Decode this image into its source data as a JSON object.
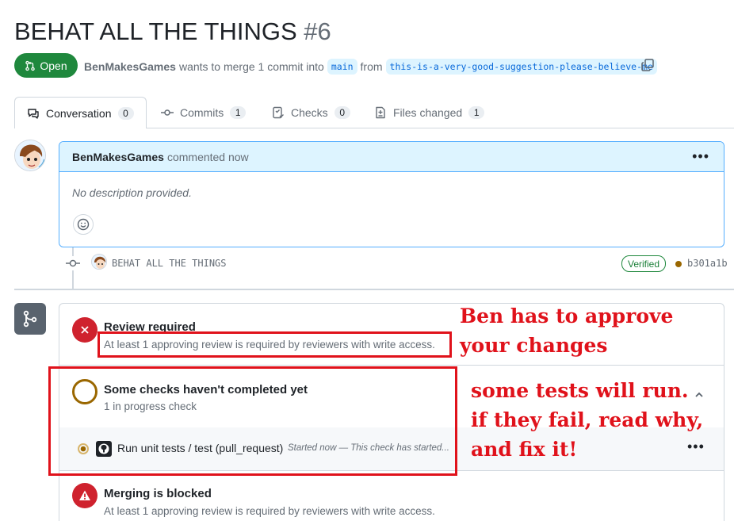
{
  "pr": {
    "title": "BEHAT ALL THE THINGS",
    "number": "#6",
    "status": "Open",
    "author": "BenMakesGames",
    "merge_text": "wants to merge 1 commit into",
    "base_branch": "main",
    "from_text": "from",
    "head_branch": "this-is-a-very-good-suggestion-please-believe-me"
  },
  "tabs": [
    {
      "label": "Conversation",
      "count": "0"
    },
    {
      "label": "Commits",
      "count": "1"
    },
    {
      "label": "Checks",
      "count": "0"
    },
    {
      "label": "Files changed",
      "count": "1"
    }
  ],
  "comment": {
    "author": "BenMakesGames",
    "time": "commented now",
    "body": "No description provided."
  },
  "commit": {
    "message": "BEHAT ALL THE THINGS",
    "verified": "Verified",
    "sha": "b301a1b"
  },
  "merge": {
    "review_title": "Review required",
    "review_sub": "At least 1 approving review is required by reviewers with write access.",
    "checks_title": "Some checks haven't completed yet",
    "checks_sub": "1 in progress check",
    "check_name": "Run unit tests / test (pull_request)",
    "check_status": "Started now — This check has started...",
    "blocked_title": "Merging is blocked",
    "blocked_sub": "At least 1 approving review is required by reviewers with write access."
  },
  "annotations": {
    "approve_line1": "Ben has to approve",
    "approve_line2": "your changes",
    "tests_line1": "some tests will run.",
    "tests_line2": "if they fail, read why,",
    "tests_line3": "and fix it!"
  },
  "colors": {
    "open_green": "#1f883d",
    "annotation_red": "#e0121b",
    "pending_brown": "#9a6700",
    "danger_red": "#cf222e"
  }
}
